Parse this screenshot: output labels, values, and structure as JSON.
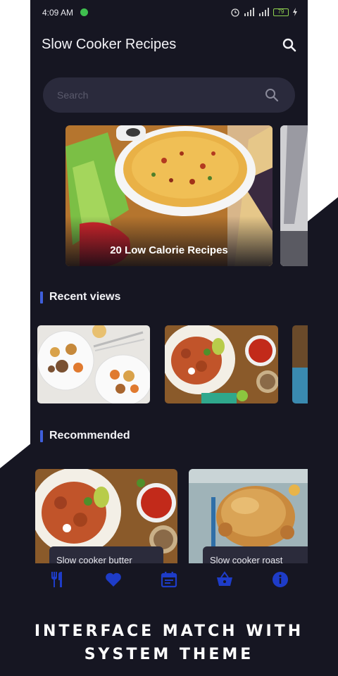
{
  "status_bar": {
    "time": "4:09 AM",
    "battery": "79"
  },
  "app_bar": {
    "title": "Slow Cooker Recipes",
    "search_icon": "search-icon"
  },
  "search": {
    "placeholder": "Search",
    "icon": "search-icon"
  },
  "featured": [
    {
      "title": "20 Low Calorie Recipes"
    }
  ],
  "sections": {
    "recent": "Recent views",
    "recommended": "Recommended"
  },
  "recommended": [
    {
      "title": "Slow cooker butter"
    },
    {
      "title": "Slow cooker roast"
    }
  ],
  "bottom_nav": [
    {
      "icon": "utensils-icon"
    },
    {
      "icon": "heart-icon"
    },
    {
      "icon": "calendar-icon"
    },
    {
      "icon": "basket-icon"
    },
    {
      "icon": "info-icon"
    }
  ],
  "banner": {
    "line1": "INTERFACE MATCH WITH",
    "line2": "SYSTEM THEME"
  },
  "colors": {
    "accent": "#3f5fdc",
    "nav_icon": "#1e3cc8",
    "background": "#161622",
    "surface": "#2a2a3c"
  }
}
